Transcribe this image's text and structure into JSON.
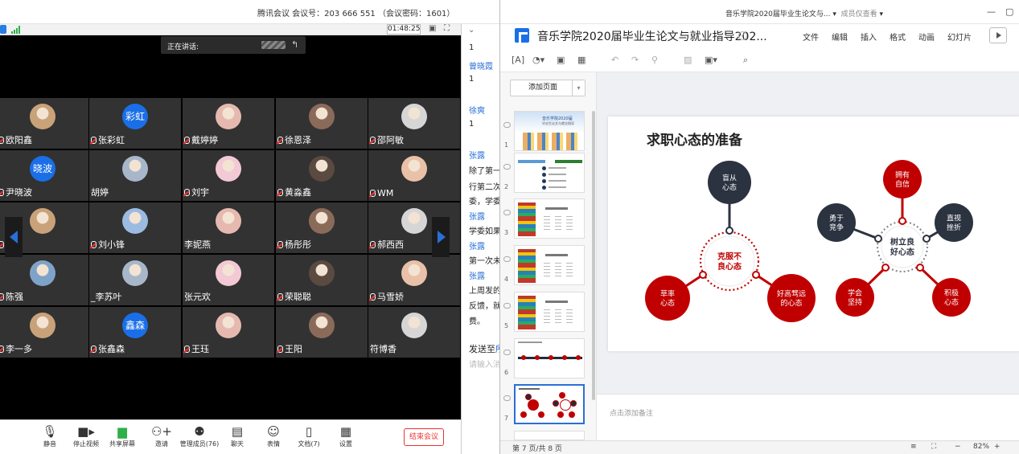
{
  "meeting": {
    "title": "腾讯会议 会议号：203 666 551 （会议密码：1601）",
    "timer": "01:48:25",
    "speaking_label": "正在讲话:",
    "participants": [
      {
        "name": "欧阳鑫",
        "muted": true
      },
      {
        "name": "张彩虹",
        "muted": true,
        "badge": "彩虹"
      },
      {
        "name": "戴婷婷",
        "muted": true
      },
      {
        "name": "徐恩泽",
        "muted": true
      },
      {
        "name": "邵阿敏",
        "muted": true
      },
      {
        "name": "尹晓波",
        "muted": true,
        "badge": "晓波"
      },
      {
        "name": "胡婷",
        "muted": false
      },
      {
        "name": "刘宇",
        "muted": true
      },
      {
        "name": "黄淼鑫",
        "muted": true
      },
      {
        "name": "WM",
        "muted": true
      },
      {
        "name": "刘",
        "muted": true
      },
      {
        "name": "刘小锋",
        "muted": true
      },
      {
        "name": "李妮燕",
        "muted": false
      },
      {
        "name": "杨彤彤",
        "muted": true
      },
      {
        "name": "郝西西",
        "muted": true
      },
      {
        "name": "陈强",
        "muted": true
      },
      {
        "name": "_李苏叶",
        "muted": false
      },
      {
        "name": "张元欢",
        "muted": false
      },
      {
        "name": "荣聪聪",
        "muted": true
      },
      {
        "name": "马雪娇",
        "muted": true
      },
      {
        "name": "李一多",
        "muted": true
      },
      {
        "name": "张鑫森",
        "muted": true,
        "badge": "鑫森"
      },
      {
        "name": "王珏",
        "muted": true
      },
      {
        "name": "王阳",
        "muted": true
      },
      {
        "name": "符博香",
        "muted": false
      }
    ],
    "toolbar": {
      "mute": "静音",
      "stop_video": "停止视频",
      "share": "共享屏幕",
      "invite": "邀请",
      "manage": "管理成员(76)",
      "chat": "聊天",
      "emoji": "表情",
      "docs": "文档(7)",
      "settings": "设置",
      "end": "结束会议"
    }
  },
  "chat": {
    "lines": [
      {
        "text": "1",
        "kind": "msg"
      },
      {
        "text": "曾晓霞",
        "kind": "name"
      },
      {
        "text": "1",
        "kind": "msg"
      },
      {
        "text": "徐爽",
        "kind": "name"
      },
      {
        "text": "1",
        "kind": "msg"
      },
      {
        "text": "张露",
        "kind": "name"
      },
      {
        "text": "除了第一",
        "kind": "msg"
      },
      {
        "text": "行第二次",
        "kind": "msg"
      },
      {
        "text": "委，学委",
        "kind": "msg"
      },
      {
        "text": "张露",
        "kind": "name"
      },
      {
        "text": "学委如果",
        "kind": "msg"
      },
      {
        "text": "张露",
        "kind": "name"
      },
      {
        "text": "第一次未",
        "kind": "msg"
      },
      {
        "text": "张露",
        "kind": "name"
      },
      {
        "text": "上周发的",
        "kind": "msg"
      },
      {
        "text": "反馈，就",
        "kind": "msg"
      },
      {
        "text": "费。",
        "kind": "msg"
      }
    ],
    "send_to_label": "发送至",
    "send_to_target": "所",
    "input_placeholder": "请输入消"
  },
  "docs": {
    "window_title": "音乐学院2020届毕业生论文与...",
    "window_sub": "成员仅查看",
    "doc_title": "音乐学院2020届毕业生论文与就业指导202...",
    "menu": [
      "文件",
      "编辑",
      "插入",
      "格式",
      "动画",
      "幻灯片"
    ],
    "add_page": "添加页面",
    "thumbs": [
      "1",
      "2",
      "3",
      "4",
      "5",
      "6",
      "7"
    ],
    "thumb1_title": "音乐学院2020届",
    "thumb1_sub": "毕业生论文与就业指导",
    "slide": {
      "title": "求职心态的准备",
      "left_center": "克服不良心态",
      "left_petals": [
        "盲从心态",
        "草率心态",
        "好高骛远的心态"
      ],
      "right_center": "树立良好心态",
      "right_petals": [
        "拥有自信",
        "勇于竞争",
        "直视挫折",
        "学会坚持",
        "积极心态"
      ]
    },
    "notes_placeholder": "点击添加备注",
    "page_status": "第 7 页/共 8 页",
    "zoom": "82%"
  },
  "colors": {
    "accent": "#2a6fd6",
    "red": "#c00000",
    "navy": "#2b3340"
  }
}
